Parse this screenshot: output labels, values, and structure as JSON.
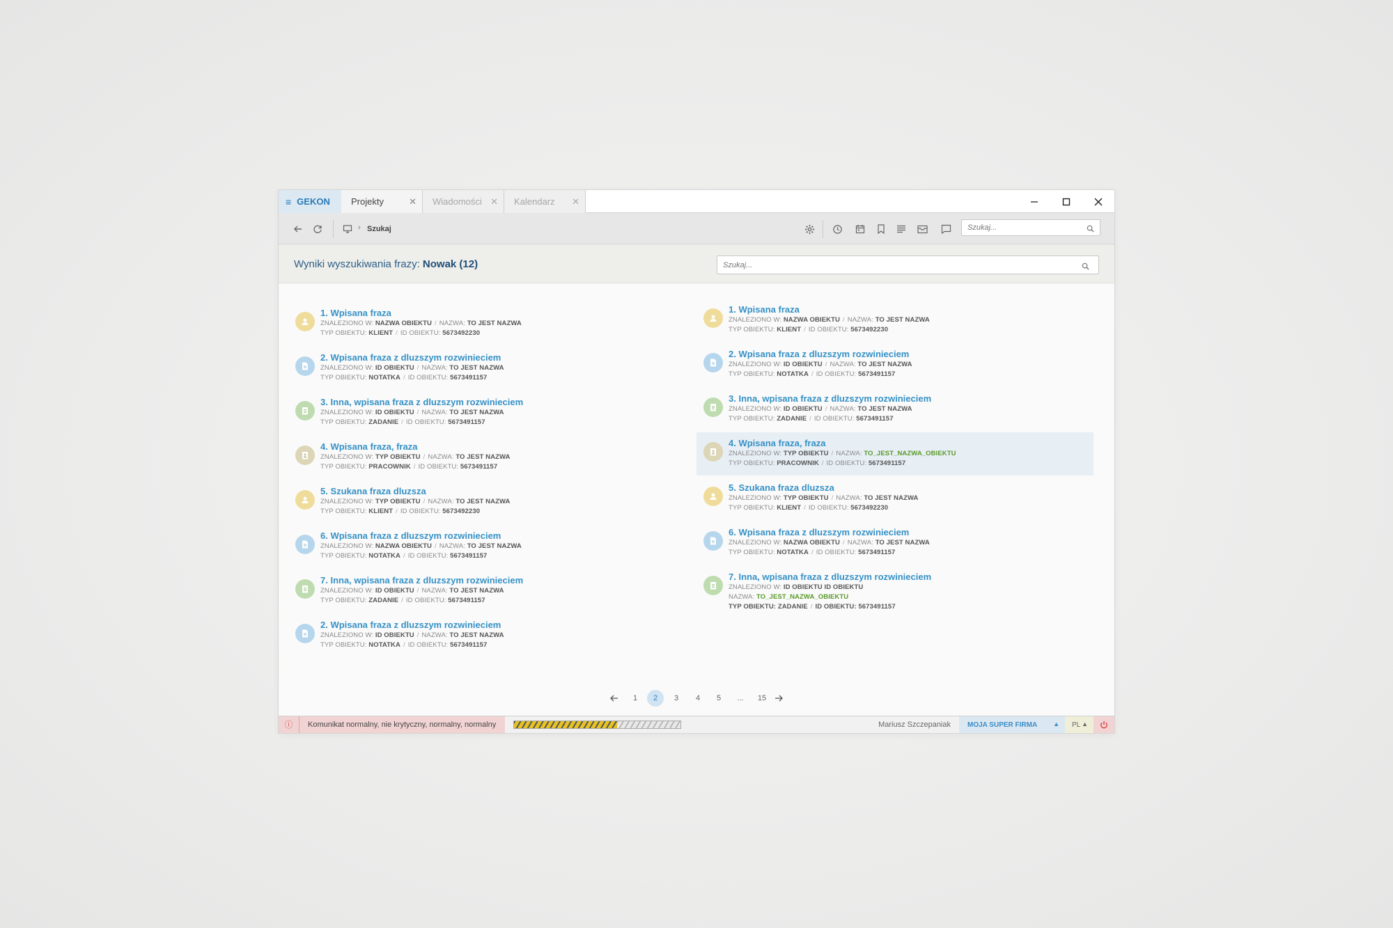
{
  "app": {
    "name": "GEKON"
  },
  "tabs": [
    {
      "label": "Projekty",
      "active": true
    },
    {
      "label": "Wiadomości",
      "active": false
    },
    {
      "label": "Kalendarz",
      "active": false
    }
  ],
  "toolbar": {
    "breadcrumb": "Szukaj",
    "search_placeholder": "Szukaj..."
  },
  "header": {
    "prefix": "Wyniki wyszukiwania frazy:",
    "phrase": "Nowak (12)",
    "search_placeholder": "Szukaj..."
  },
  "labels": {
    "found_in": "ZNALEZIONO W:",
    "name": "NAZWA:",
    "object_type": "TYP OBIEKTU:",
    "object_id": "ID OBIEKTU:"
  },
  "colors": {
    "klient": "#f0dc9a",
    "notatka": "#b5d6ec",
    "zadanie": "#bedcaf",
    "pracownik": "#dcd6b7",
    "accent": "#3591c6"
  },
  "results_left": [
    {
      "title": "1. Wpisana fraza",
      "found_in": "NAZWA OBIEKTU",
      "name": "TO JEST NAZWA",
      "type": "KLIENT",
      "id": "5673492230",
      "icon": "person-icon",
      "kind": "klient"
    },
    {
      "title": "2. Wpisana fraza z dluzszym rozwinieciem",
      "found_in": "ID OBIEKTU",
      "name": "TO JEST NAZWA",
      "type": "NOTATKA",
      "id": "5673491157",
      "icon": "note-icon",
      "kind": "notatka"
    },
    {
      "title": "3. Inna, wpisana fraza z dluzszym rozwinieciem",
      "found_in": "ID OBIEKTU",
      "name": "TO JEST NAZWA",
      "type": "ZADANIE",
      "id": "5673491157",
      "icon": "task-icon",
      "kind": "zadanie"
    },
    {
      "title": "4. Wpisana fraza, fraza",
      "found_in": "TYP OBIEKTU",
      "name": "TO JEST NAZWA",
      "type": "PRACOWNIK",
      "id": "5673491157",
      "icon": "employee-icon",
      "kind": "pracownik"
    },
    {
      "title": "5. Szukana fraza dluzsza",
      "found_in": "TYP OBIEKTU",
      "name": "TO JEST NAZWA",
      "type": "KLIENT",
      "id": "5673492230",
      "icon": "person-icon",
      "kind": "klient"
    },
    {
      "title": "6. Wpisana fraza z dluzszym rozwinieciem",
      "found_in": "NAZWA OBIEKTU",
      "name": "TO JEST NAZWA",
      "type": "NOTATKA",
      "id": "5673491157",
      "icon": "note-icon",
      "kind": "notatka"
    },
    {
      "title": "7. Inna, wpisana fraza z dluzszym rozwinieciem",
      "found_in": "ID OBIEKTU",
      "name": "TO JEST NAZWA",
      "type": "ZADANIE",
      "id": "5673491157",
      "icon": "task-icon",
      "kind": "zadanie"
    },
    {
      "title": "2. Wpisana fraza z dluzszym rozwinieciem",
      "found_in": "ID OBIEKTU",
      "name": "TO JEST NAZWA",
      "type": "NOTATKA",
      "id": "5673491157",
      "icon": "note-icon",
      "kind": "notatka"
    }
  ],
  "results_right": [
    {
      "title": "1. Wpisana fraza",
      "found_in": "NAZWA OBIEKTU",
      "name": "TO JEST NAZWA",
      "type": "KLIENT",
      "id": "5673492230",
      "icon": "person-icon",
      "kind": "klient"
    },
    {
      "title": "2. Wpisana fraza z dluzszym rozwinieciem",
      "found_in": "ID OBIEKTU",
      "name": "TO JEST NAZWA",
      "type": "NOTATKA",
      "id": "5673491157",
      "icon": "note-icon",
      "kind": "notatka"
    },
    {
      "title": "3. Inna, wpisana fraza z dluzszym rozwinieciem",
      "found_in": "ID OBIEKTU",
      "name": "TO JEST NAZWA",
      "type": "ZADANIE",
      "id": "5673491157",
      "icon": "task-icon",
      "kind": "zadanie"
    },
    {
      "title": "4. Wpisana fraza, fraza",
      "found_in": "TYP OBIEKTU",
      "name": "TO_JEST_NAZWA_OBIEKTU",
      "type": "PRACOWNIK",
      "id": "5673491157",
      "icon": "employee-icon",
      "kind": "pracownik",
      "highlighted": true
    },
    {
      "title": "5. Szukana fraza dluzsza",
      "found_in": "TYP OBIEKTU",
      "name": "TO JEST NAZWA",
      "type": "KLIENT",
      "id": "5673492230",
      "icon": "person-icon",
      "kind": "klient"
    },
    {
      "title": "6. Wpisana fraza z dluzszym rozwinieciem",
      "found_in": "NAZWA OBIEKTU",
      "name": "TO JEST NAZWA",
      "type": "NOTATKA",
      "id": "5673491157",
      "icon": "note-icon",
      "kind": "notatka"
    },
    {
      "title": "7. Inna, wpisana fraza z dluzszym rozwinieciem",
      "found_in": "ID OBIEKTU ID OBIEKTU",
      "name": "TO_JEST_NAZWA_OBIEKTU",
      "type": "ZADANIE",
      "id": "5673491157",
      "icon": "task-icon",
      "kind": "zadanie",
      "wrapped": true
    }
  ],
  "pagination": {
    "pages": [
      "1",
      "2",
      "3",
      "4",
      "5",
      "...",
      "15"
    ],
    "current": "2"
  },
  "status": {
    "message": "Komunikat normalny, nie krytyczny, normalny, normalny",
    "progress": 0.62,
    "user": "Mariusz Szczepaniak",
    "company": "MOJA SUPER FIRMA",
    "language": "PL"
  }
}
